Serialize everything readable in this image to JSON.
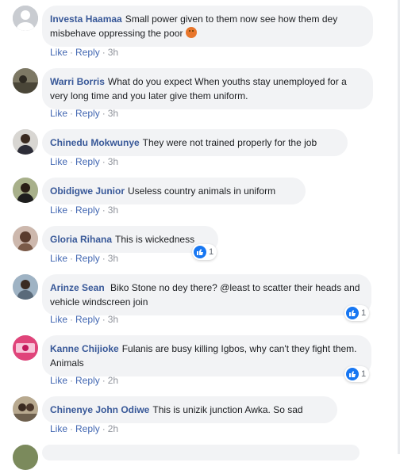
{
  "comments": [
    {
      "author": "Investa Haamaa",
      "text": "Small power given to them now see how them dey misbehave oppressing the poor",
      "emoji": "angry-face-emoji",
      "like": "Like",
      "reply": "Reply",
      "time": "3h",
      "avatar_color": "#b8bcc4"
    },
    {
      "author": "Warri Borris",
      "text": "What do you expect When youths stay unemployed for a very long time and you later give them uniform.",
      "like": "Like",
      "reply": "Reply",
      "time": "3h",
      "avatar_color": "#6b6650"
    },
    {
      "author": "Chinedu Mokwunye",
      "text": "They were not trained properly for the job",
      "like": "Like",
      "reply": "Reply",
      "time": "3h",
      "avatar_color": "#3d3d46"
    },
    {
      "author": "Obidigwe Junior",
      "text": "Useless country animals in uniform",
      "like": "Like",
      "reply": "Reply",
      "time": "3h",
      "avatar_color": "#4e5a3a"
    },
    {
      "author": "Gloria Rihana",
      "text": "This is wickedness",
      "like": "Like",
      "reply": "Reply",
      "time": "3h",
      "reaction_count": "1",
      "avatar_color": "#8a6e63"
    },
    {
      "author": "Arinze Sean",
      "text": "Biko Stone no dey there? @least to scatter their heads and vehicle windscreen join",
      "like": "Like",
      "reply": "Reply",
      "time": "3h",
      "reaction_count": "1",
      "avatar_color": "#6d7f8f"
    },
    {
      "author": "Kanne Chijioke",
      "text": "Fulanis are busy killing Igbos, why can't they fight them. Animals",
      "like": "Like",
      "reply": "Reply",
      "time": "2h",
      "reaction_count": "1",
      "avatar_color": "#c2185b"
    },
    {
      "author": "Chinenye John Odiwe",
      "text": "This is unizik junction Awka. So sad",
      "like": "Like",
      "reply": "Reply",
      "time": "2h",
      "avatar_color": "#8d7f6b"
    }
  ],
  "colors": {
    "author": "#385898",
    "link": "#4267b2",
    "bubble": "#f2f3f5",
    "like_badge": "#1877f2"
  }
}
